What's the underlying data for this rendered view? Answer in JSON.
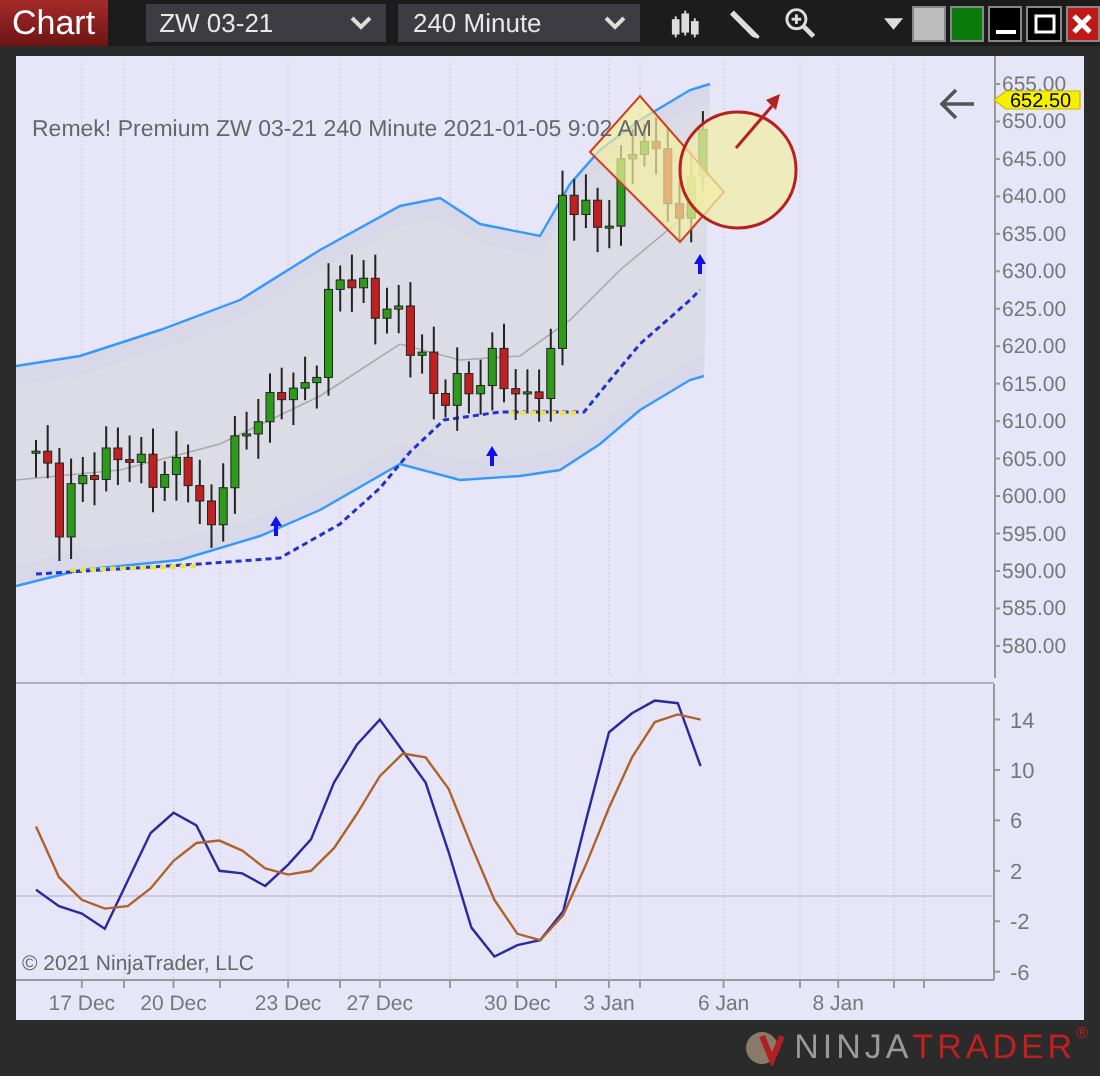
{
  "toolbar": {
    "title": "Chart",
    "instrument": "ZW 03-21",
    "interval": "240 Minute"
  },
  "price_panel": {
    "header": "Remek!  Premium  ZW 03-21  240 Minute  2021-01-05 9:02 AM",
    "last_price": "652.50",
    "price_axis": [
      "655.00",
      "650.00",
      "645.00",
      "640.00",
      "635.00",
      "630.00",
      "625.00",
      "620.00",
      "615.00",
      "610.00",
      "605.00",
      "600.00",
      "595.00",
      "590.00",
      "585.00",
      "580.00"
    ]
  },
  "oscillator": {
    "chart_data": {
      "type": "line",
      "grid": true,
      "ylim": [
        -6.5,
        16.5
      ],
      "yticks": [
        -6,
        -2,
        2,
        6,
        10,
        14
      ],
      "categories": [
        null,
        null,
        "17 Dec",
        null,
        null,
        null,
        "20 Dec",
        null,
        null,
        null,
        null,
        "23 Dec",
        null,
        null,
        null,
        "27 Dec",
        null,
        null,
        null,
        null,
        null,
        "30 Dec",
        null,
        null,
        null,
        "3 Jan",
        null,
        null,
        null,
        null,
        "6 Jan",
        null,
        null,
        null,
        null,
        "8 Jan",
        null,
        null,
        null,
        null,
        null,
        null
      ],
      "series": [
        {
          "color": "#2a2aa0",
          "values": [
            0.5,
            -0.8,
            -1.4,
            -2.6,
            1.2,
            5,
            6.6,
            5.6,
            2,
            1.8,
            0.8,
            2.5,
            4.5,
            9,
            12,
            14,
            11.5,
            9,
            3.5,
            -2.5,
            -4.8,
            -3.9,
            -3.5,
            -1.2,
            6,
            13,
            14.5,
            15.5,
            15.3,
            10.3,
            null,
            null,
            null,
            null,
            null,
            null,
            null,
            null,
            null,
            null,
            null,
            null
          ]
        },
        {
          "color": "#b0622a",
          "values": [
            5.5,
            1.5,
            -0.3,
            -1,
            -0.8,
            0.6,
            2.8,
            4.2,
            4.4,
            3.6,
            2.2,
            1.7,
            2,
            3.8,
            6.5,
            9.5,
            11.3,
            11,
            8.5,
            4,
            -0.3,
            -3,
            -3.5,
            -1.5,
            2.5,
            7,
            11,
            13.8,
            14.4,
            14,
            null,
            null,
            null,
            null,
            null,
            null,
            null,
            null,
            null,
            null,
            null,
            null
          ]
        }
      ]
    }
  },
  "copyright": "© 2021 NinjaTrader, LLC",
  "brand": {
    "part_1": "NINJA",
    "part_2": "TRADER",
    "mark": "®"
  }
}
